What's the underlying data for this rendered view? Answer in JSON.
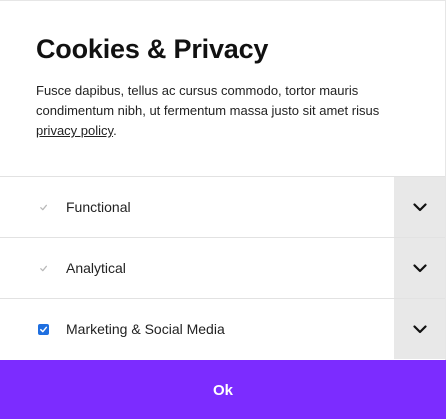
{
  "modal": {
    "title": "Cookies & Privacy",
    "description": "Fusce dapibus, tellus ac cursus commodo, tortor mauris condimentum nibh, ut fermentum massa justo sit amet risus ",
    "policy_link": "privacy policy",
    "policy_suffix": "."
  },
  "options": [
    {
      "label": "Functional",
      "checked": true,
      "disabled": true
    },
    {
      "label": "Analytical",
      "checked": true,
      "disabled": true
    },
    {
      "label": "Marketing & Social Media",
      "checked": true,
      "disabled": false
    }
  ],
  "ok_label": "Ok",
  "colors": {
    "accent": "#7c2cff",
    "checkbox_blue": "#1f6fe0",
    "expand_bg": "#e8e8e8"
  },
  "icons": {
    "expand": "chevron-down-icon",
    "check": "check-icon"
  }
}
